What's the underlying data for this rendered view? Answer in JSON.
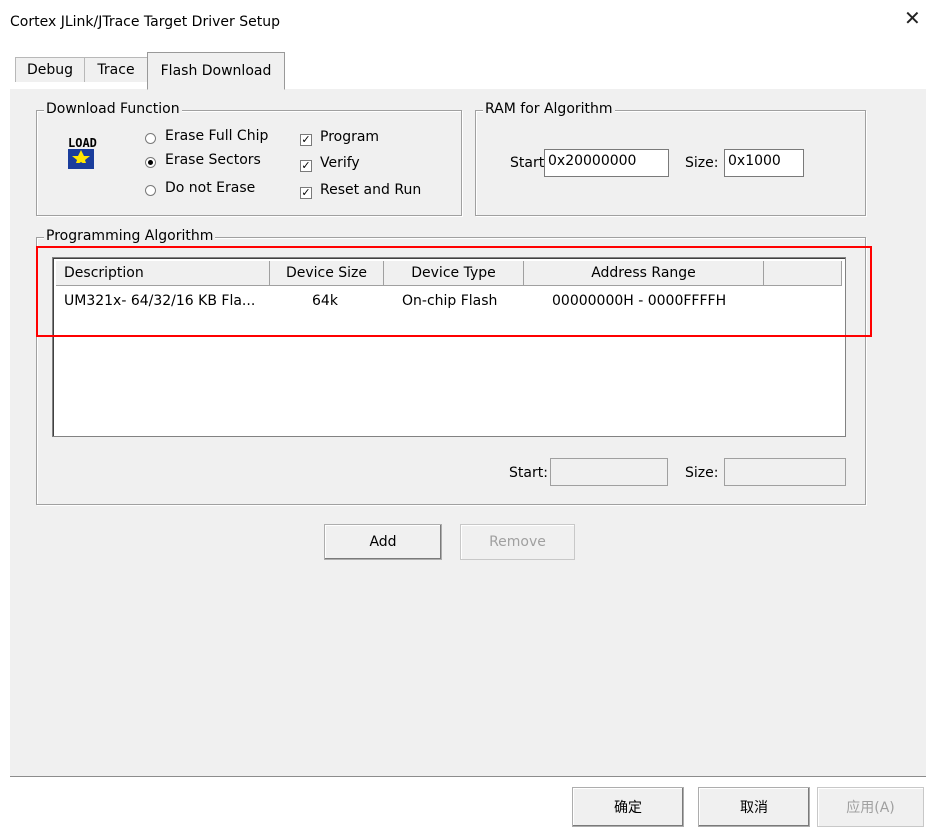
{
  "window": {
    "title": "Cortex JLink/JTrace Target Driver Setup",
    "close_glyph": "✕"
  },
  "tabs": [
    {
      "label": "Debug"
    },
    {
      "label": "Trace"
    },
    {
      "label": "Flash Download",
      "active": true
    }
  ],
  "download_function": {
    "legend": "Download Function",
    "icon": "load-icon",
    "radios": [
      {
        "label": "Erase Full Chip",
        "selected": false
      },
      {
        "label": "Erase Sectors",
        "selected": true
      },
      {
        "label": "Do not Erase",
        "selected": false
      }
    ],
    "checkboxes": [
      {
        "label": "Program",
        "checked": true
      },
      {
        "label": "Verify",
        "checked": true
      },
      {
        "label": "Reset and Run",
        "checked": true
      }
    ]
  },
  "ram_for_algorithm": {
    "legend": "RAM for Algorithm",
    "start_label": "Start:",
    "start_value": "0x20000000",
    "size_label": "Size:",
    "size_value": "0x1000"
  },
  "programming_algorithm": {
    "legend": "Programming Algorithm",
    "columns": [
      "Description",
      "Device Size",
      "Device Type",
      "Address Range"
    ],
    "rows": [
      {
        "description": "UM321x- 64/32/16 KB Fla...",
        "device_size": "64k",
        "device_type": "On-chip Flash",
        "address_range": "00000000H - 0000FFFFH"
      }
    ],
    "start_label": "Start:",
    "start_value": "",
    "size_label": "Size:",
    "size_value": ""
  },
  "buttons": {
    "add": "Add",
    "remove": "Remove"
  },
  "footer": {
    "ok": "确定",
    "cancel": "取消",
    "apply": "应用(A)"
  },
  "colors": {
    "highlight": "#ff0000",
    "panel": "#f0f0f0"
  }
}
